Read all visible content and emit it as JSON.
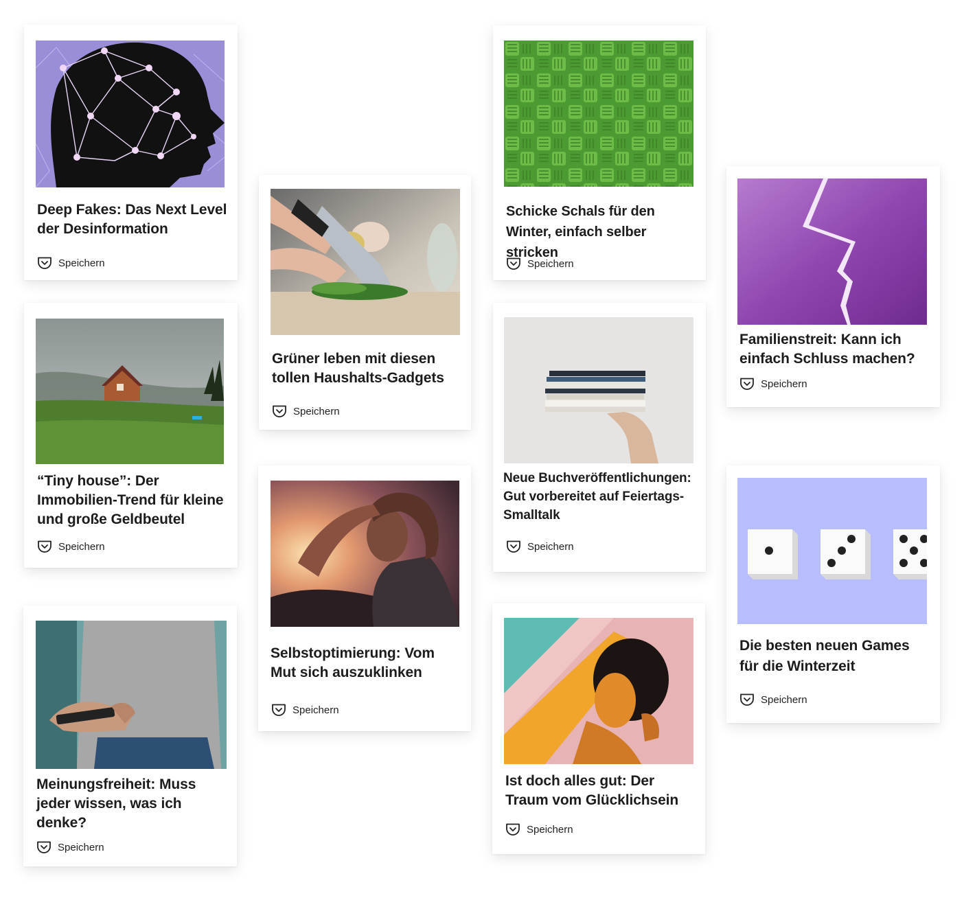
{
  "cards": [
    {
      "title": "Deep Fakes: Das Next Level der Desinformation",
      "save_label": "Speichern",
      "image": "face-network-illustration"
    },
    {
      "title": "Grüner leben mit diesen tollen Haushalts-Gadgets",
      "save_label": "Speichern",
      "image": "cutting-herbs-photo"
    },
    {
      "title": "Schicke Schals für den Winter, einfach selber stricken",
      "save_label": "Speichern",
      "image": "green-knit-texture"
    },
    {
      "title": "Familienstreit: Kann ich einfach Schluss machen?",
      "save_label": "Speichern",
      "image": "purple-crack-illustration"
    },
    {
      "title": "“Tiny house”: Der Immobilien-Trend für kleine und große Geldbeutel",
      "save_label": "Speichern",
      "image": "cabin-on-hill-photo"
    },
    {
      "title": "Neue Buchveröffentlichungen: Gut vorbereitet auf Feiertags-Smalltalk",
      "save_label": "Speichern",
      "image": "book-stack-photo"
    },
    {
      "title": "Selbstoptimierung: Vom Mut sich auszuklinken",
      "save_label": "Speichern",
      "image": "man-sunset-photo"
    },
    {
      "title": "Die besten neuen Games für die Winterzeit",
      "save_label": "Speichern",
      "image": "dice-illustration"
    },
    {
      "title": "Meinungsfreiheit: Muss jeder wissen, was ich denke?",
      "save_label": "Speichern",
      "image": "person-phone-photo"
    },
    {
      "title": "Ist doch alles gut: Der Traum vom Glücklichsein",
      "save_label": "Speichern",
      "image": "woman-sunlight-photo"
    }
  ],
  "colors": {
    "save_icon": "#222222",
    "title_text": "#1c1c1c"
  }
}
